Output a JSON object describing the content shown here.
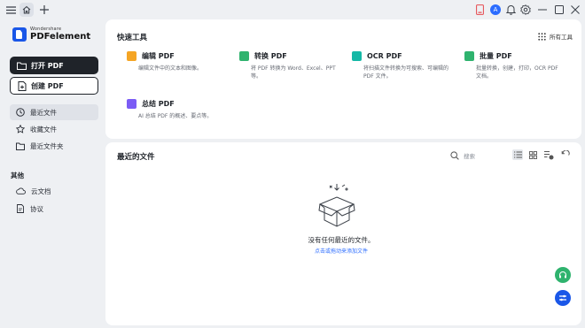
{
  "titlebar": {
    "menu_icon": "hamburger-icon",
    "home_icon": "home-icon",
    "new_tab_icon": "plus-icon",
    "avatar_letter": "A"
  },
  "sidebar": {
    "brand": "Wondershare",
    "product": "PDFelement",
    "open_pdf": "打开 PDF",
    "create_pdf": "创建 PDF",
    "nav": [
      {
        "label": "最近文件",
        "icon": "clock-icon"
      },
      {
        "label": "收藏文件",
        "icon": "star-icon"
      },
      {
        "label": "最近文件夹",
        "icon": "folder-icon"
      }
    ],
    "other_label": "其他",
    "other": [
      {
        "label": "云文档",
        "icon": "cloud-icon"
      },
      {
        "label": "协议",
        "icon": "document-icon"
      }
    ]
  },
  "quick_tools": {
    "title": "快速工具",
    "all_tools": "所有工具",
    "tools": [
      {
        "name": "编辑 PDF",
        "desc": "编辑文件中的文本和图像。",
        "color": "#f5a524"
      },
      {
        "name": "转换 PDF",
        "desc": "将 PDF 转换为 Word、Excel、PPT 等。",
        "color": "#2fb36e"
      },
      {
        "name": "OCR PDF",
        "desc": "将扫描文件转换为可搜索、可编辑的 PDF 文件。",
        "color": "#15b8a6"
      },
      {
        "name": "批量 PDF",
        "desc": "批量转换，创建，打印，OCR PDF 文档。",
        "color": "#2fb36e"
      },
      {
        "name": "总结 PDF",
        "desc": "AI 总结 PDF 的概述、要点等。",
        "color": "#7b5cf5"
      }
    ]
  },
  "recent": {
    "title": "最近的文件",
    "search_placeholder": "搜索",
    "empty_title": "没有任何最近的文件。",
    "empty_link": "点击或拖动来添加文件"
  },
  "colors": {
    "accent": "#1a57e8",
    "link": "#2b6cff",
    "fab_green": "#2fb36e",
    "fab_blue": "#1a57e8",
    "avatar": "#2b6cff"
  }
}
